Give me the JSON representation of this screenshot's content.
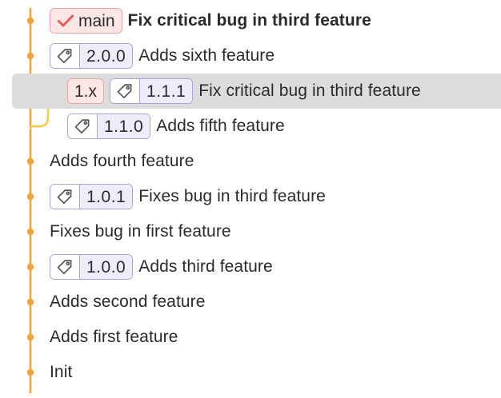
{
  "colors": {
    "main_lane": "#efa53a",
    "side_lane": "#f4ce4a",
    "branch_badge_bg": "#fde6e6",
    "branch_badge_border": "#e9a4a4",
    "check": "#e85b5b",
    "tag_border": "#a9a4de",
    "tag_bg": "#eeecfa",
    "selected_row_bg": "#dcdcdc"
  },
  "commits": [
    {
      "message": "Fix critical bug in third feature",
      "bold": true,
      "branch": "main",
      "branch_icon": "checkmark-icon",
      "tag": null,
      "lane": 0
    },
    {
      "message": "Adds sixth feature",
      "bold": false,
      "branch": null,
      "tag": "2.0.0",
      "lane": 0
    },
    {
      "message": "Fix critical bug in third feature",
      "bold": false,
      "branch": "1.x",
      "tag": "1.1.1",
      "lane": 1,
      "selected": true
    },
    {
      "message": "Adds fifth feature",
      "bold": false,
      "branch": null,
      "tag": "1.1.0",
      "lane": 1
    },
    {
      "message": "Adds fourth feature",
      "bold": false,
      "branch": null,
      "tag": null,
      "lane": 0
    },
    {
      "message": "Fixes bug in third feature",
      "bold": false,
      "branch": null,
      "tag": "1.0.1",
      "lane": 0
    },
    {
      "message": "Fixes bug in first feature",
      "bold": false,
      "branch": null,
      "tag": null,
      "lane": 0
    },
    {
      "message": "Adds third feature",
      "bold": false,
      "branch": null,
      "tag": "1.0.0",
      "lane": 0
    },
    {
      "message": "Adds second feature",
      "bold": false,
      "branch": null,
      "tag": null,
      "lane": 0
    },
    {
      "message": "Adds first feature",
      "bold": false,
      "branch": null,
      "tag": null,
      "lane": 0
    },
    {
      "message": "Init",
      "bold": false,
      "branch": null,
      "tag": null,
      "lane": 0
    }
  ]
}
